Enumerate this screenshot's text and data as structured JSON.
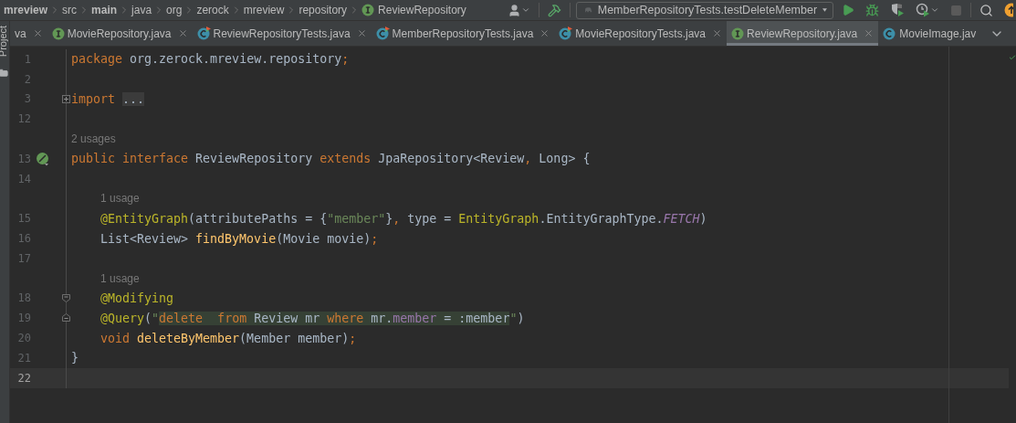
{
  "breadcrumbs": [
    {
      "label": "mreview",
      "bold": true,
      "kind": "folder"
    },
    {
      "label": "src",
      "bold": false,
      "kind": "folder"
    },
    {
      "label": "main",
      "bold": true,
      "kind": "folder"
    },
    {
      "label": "java",
      "bold": false,
      "kind": "folder"
    },
    {
      "label": "org",
      "bold": false,
      "kind": "folder"
    },
    {
      "label": "zerock",
      "bold": false,
      "kind": "folder"
    },
    {
      "label": "mreview",
      "bold": false,
      "kind": "folder"
    },
    {
      "label": "repository",
      "bold": false,
      "kind": "folder"
    },
    {
      "label": "ReviewRepository",
      "bold": false,
      "kind": "interface"
    }
  ],
  "toolbar": {
    "run_configuration": "MemberRepositoryTests.testDeleteMember"
  },
  "tool_window": {
    "label": "Project"
  },
  "tabs": [
    {
      "label": "va",
      "kind": "plain",
      "selected": false,
      "closable": true
    },
    {
      "label": "MovieRepository.java",
      "kind": "interface",
      "selected": false,
      "closable": true
    },
    {
      "label": "ReviewRepositoryTests.java",
      "kind": "test-class",
      "selected": false,
      "closable": true
    },
    {
      "label": "MemberRepositoryTests.java",
      "kind": "test-class",
      "selected": false,
      "closable": true
    },
    {
      "label": "MovieRepositoryTests.java",
      "kind": "test-class",
      "selected": false,
      "closable": true
    },
    {
      "label": "ReviewRepository.java",
      "kind": "interface",
      "selected": true,
      "closable": true
    },
    {
      "label": "MovieImage.jav",
      "kind": "class",
      "selected": false,
      "closable": false
    }
  ],
  "editor": {
    "lines": [
      {
        "kind": "code",
        "number": "1",
        "current": false,
        "indented": false,
        "tokens": [
          {
            "kind": "keyword",
            "text": "package "
          },
          {
            "kind": "plain",
            "text": "org.zerock.mreview.repository"
          },
          {
            "kind": "keyword",
            "text": ";"
          }
        ]
      },
      {
        "kind": "code",
        "number": "2",
        "current": false
      },
      {
        "kind": "code",
        "number": "3",
        "current": false,
        "indented": false,
        "gutter": {
          "kind": "fold-plus"
        },
        "tokens": [
          {
            "kind": "keyword",
            "text": "import "
          },
          {
            "kind": "folded",
            "text": "..."
          }
        ]
      },
      {
        "kind": "code",
        "number": "12",
        "current": false
      },
      {
        "kind": "hint",
        "text": "2 usages",
        "indented": false
      },
      {
        "kind": "code",
        "number": "13",
        "current": false,
        "indented": false,
        "gutter": {
          "kind": "bean"
        },
        "tokens": [
          {
            "kind": "keyword",
            "text": "public interface "
          },
          {
            "kind": "plain",
            "text": "ReviewRepository "
          },
          {
            "kind": "keyword",
            "text": "extends "
          },
          {
            "kind": "plain",
            "text": "JpaRepository<Review"
          },
          {
            "kind": "keyword",
            "text": ", "
          },
          {
            "kind": "plain",
            "text": "Long> {"
          }
        ]
      },
      {
        "kind": "code",
        "number": "14",
        "current": false
      },
      {
        "kind": "hint",
        "text": "1 usage",
        "indented": true
      },
      {
        "kind": "code",
        "number": "15",
        "current": false,
        "indented": true,
        "tokens": [
          {
            "kind": "annotation",
            "text": "@EntityGraph"
          },
          {
            "kind": "plain",
            "text": "(attributePaths = {"
          },
          {
            "kind": "string",
            "text": "\"member\""
          },
          {
            "kind": "plain",
            "text": "}"
          },
          {
            "kind": "keyword",
            "text": ", "
          },
          {
            "kind": "plain",
            "text": "type = "
          },
          {
            "kind": "annotation",
            "text": "EntityGraph"
          },
          {
            "kind": "plain",
            "text": ".EntityGraphType."
          },
          {
            "kind": "static",
            "text": "FETCH"
          },
          {
            "kind": "plain",
            "text": ")"
          }
        ]
      },
      {
        "kind": "code",
        "number": "16",
        "current": false,
        "indented": true,
        "tokens": [
          {
            "kind": "plain",
            "text": "List<Review> "
          },
          {
            "kind": "method",
            "text": "findByMovie"
          },
          {
            "kind": "plain",
            "text": "(Movie movie)"
          },
          {
            "kind": "keyword",
            "text": ";"
          }
        ]
      },
      {
        "kind": "code",
        "number": "17",
        "current": false
      },
      {
        "kind": "hint",
        "text": "1 usage",
        "indented": true
      },
      {
        "kind": "code",
        "number": "18",
        "current": false,
        "indented": true,
        "gutter": {
          "kind": "fold-start"
        },
        "tokens": [
          {
            "kind": "annotation",
            "text": "@Modifying"
          }
        ]
      },
      {
        "kind": "code",
        "number": "19",
        "current": false,
        "indented": true,
        "gutter": {
          "kind": "fold-end"
        },
        "tokens": [
          {
            "kind": "annotation",
            "text": "@Query"
          },
          {
            "kind": "plain",
            "text": "("
          },
          {
            "kind": "string",
            "text": "\""
          },
          {
            "kind": "injection",
            "tokens": [
              {
                "kind": "keyword",
                "text": "delete  from"
              },
              {
                "kind": "plain",
                "text": " Review mr "
              },
              {
                "kind": "keyword",
                "text": "where"
              },
              {
                "kind": "plain",
                "text": " mr."
              },
              {
                "kind": "field",
                "text": "member"
              },
              {
                "kind": "plain",
                "text": " = :member"
              }
            ]
          },
          {
            "kind": "string",
            "text": "\""
          },
          {
            "kind": "plain",
            "text": ")"
          }
        ]
      },
      {
        "kind": "code",
        "number": "20",
        "current": false,
        "indented": true,
        "tokens": [
          {
            "kind": "keyword",
            "text": "void "
          },
          {
            "kind": "method",
            "text": "deleteByMember"
          },
          {
            "kind": "plain",
            "text": "(Member member)"
          },
          {
            "kind": "keyword",
            "text": ";"
          }
        ]
      },
      {
        "kind": "code",
        "number": "21",
        "current": false,
        "indented": false,
        "tokens": [
          {
            "kind": "plain",
            "text": "}"
          }
        ]
      },
      {
        "kind": "code",
        "number": "22",
        "current": true
      }
    ]
  }
}
